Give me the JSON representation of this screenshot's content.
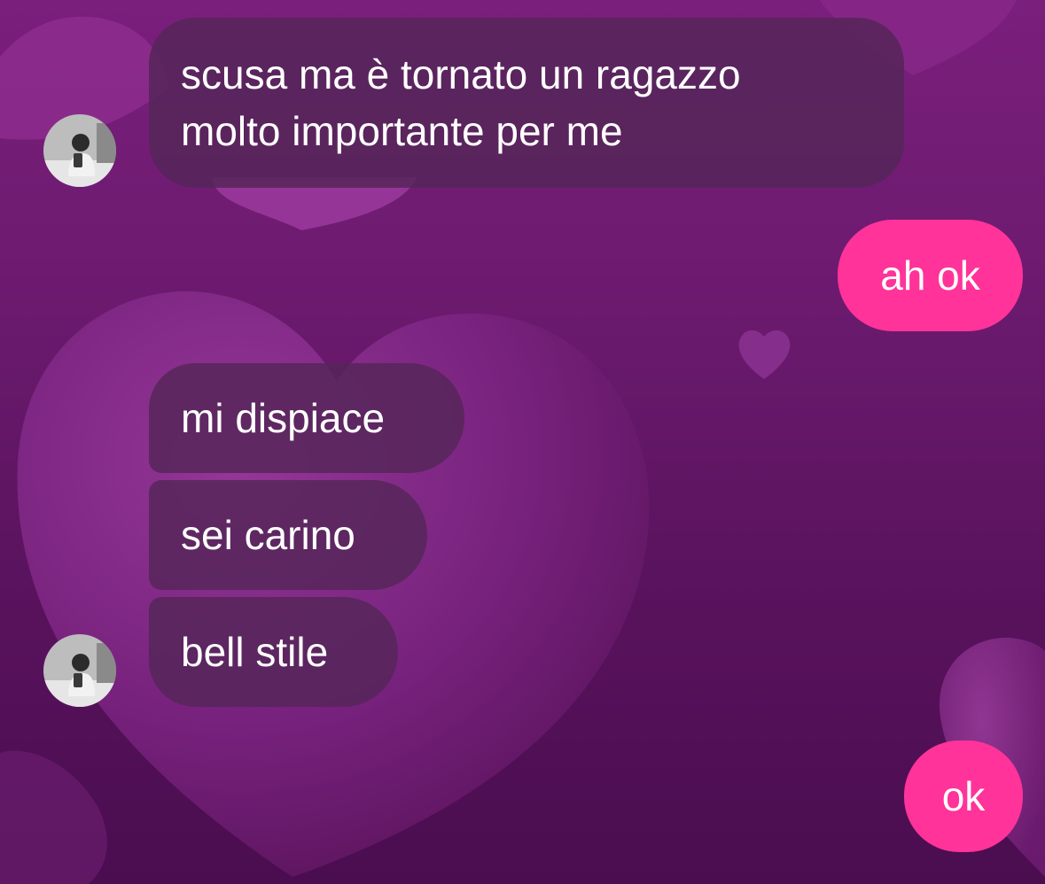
{
  "chat": {
    "messages": [
      {
        "sender": "contact",
        "text_lines": [
          "scusa ma è tornato un ragazzo",
          "molto importante per me"
        ]
      },
      {
        "sender": "me",
        "text": "ah ok"
      },
      {
        "sender": "contact",
        "text": "mi dispiace"
      },
      {
        "sender": "contact",
        "text": "sei carino"
      },
      {
        "sender": "contact",
        "text": "bell stile"
      },
      {
        "sender": "me",
        "text": "ok"
      }
    ]
  },
  "theme": {
    "background_primary": "#6b1a6e",
    "incoming_bubble": "#542658",
    "outgoing_bubble": "#ff3399",
    "text": "#ffffff",
    "wallpaper_motif": "hearts"
  },
  "icons": {
    "avatar": "contact-avatar-photo"
  }
}
